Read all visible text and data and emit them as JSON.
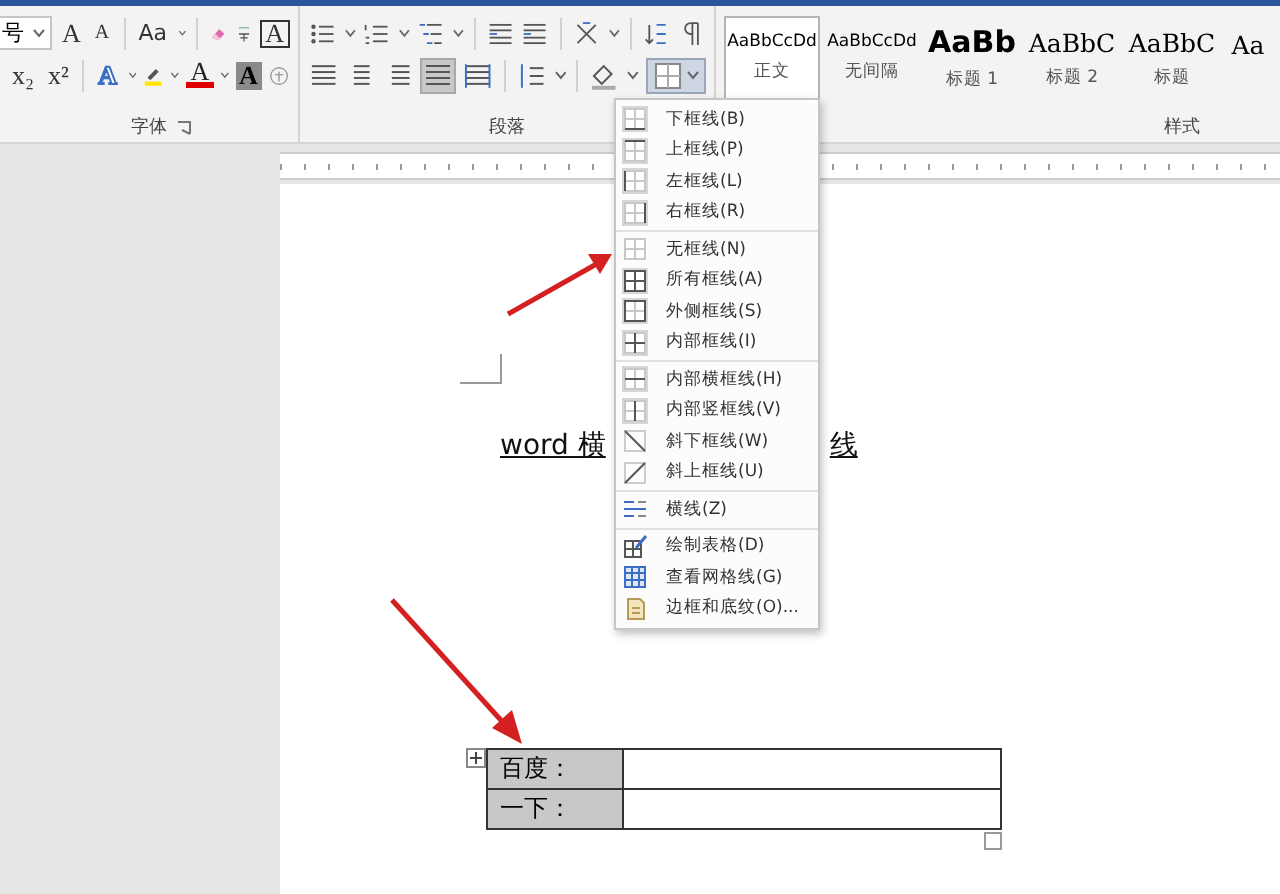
{
  "ribbon": {
    "font": {
      "size_value": "号",
      "row1": [
        {
          "kind": "grow",
          "text": "A"
        },
        {
          "kind": "shrink",
          "text": "A"
        },
        {
          "kind": "case",
          "text": "Aa"
        },
        {
          "kind": "boxed",
          "text": "A"
        }
      ],
      "row2": [
        {
          "kind": "sub",
          "text": "x₂"
        },
        {
          "kind": "sup",
          "text": "x²"
        },
        {
          "kind": "outline",
          "text": "A"
        },
        {
          "kind": "color",
          "text": "A"
        },
        {
          "kind": "shaded",
          "text": "A"
        }
      ],
      "label": "字体"
    },
    "paragraph": {
      "label": "段落"
    },
    "styles": {
      "items": [
        {
          "kind": "normal",
          "preview": "AaBbCcDd",
          "name": "正文",
          "selected": true
        },
        {
          "kind": "normal",
          "preview": "AaBbCcDd",
          "name": "无间隔",
          "selected": false
        },
        {
          "kind": "heading1",
          "preview": "AaBb",
          "name": "标题 1",
          "selected": false
        },
        {
          "kind": "heading2",
          "preview": "AaBbC",
          "name": "标题 2",
          "selected": false
        },
        {
          "kind": "heading2",
          "preview": "AaBbC",
          "name": "标题",
          "selected": false
        },
        {
          "kind": "heading2",
          "preview": "Aa",
          "selected": false
        }
      ],
      "label": "样式"
    }
  },
  "border_menu": {
    "sections": [
      [
        {
          "kind": "bottom",
          "label": "下框线(B)"
        },
        {
          "kind": "top",
          "label": "上框线(P)"
        },
        {
          "kind": "left",
          "label": "左框线(L)"
        },
        {
          "kind": "right",
          "label": "右框线(R)"
        }
      ],
      [
        {
          "kind": "none",
          "label": "无框线(N)"
        },
        {
          "kind": "all",
          "label": "所有框线(A)"
        },
        {
          "kind": "outside",
          "label": "外侧框线(S)"
        },
        {
          "kind": "inside",
          "label": "内部框线(I)"
        }
      ],
      [
        {
          "kind": "inside_h",
          "label": "内部横框线(H)"
        },
        {
          "kind": "inside_v",
          "label": "内部竖框线(V)"
        },
        {
          "kind": "diag_down",
          "label": "斜下框线(W)"
        },
        {
          "kind": "diag_up",
          "label": "斜上框线(U)"
        }
      ],
      [
        {
          "kind": "hline",
          "label": "横线(Z)"
        }
      ],
      [
        {
          "kind": "draw",
          "label": "绘制表格(D)"
        },
        {
          "kind": "grid",
          "label": "查看网格线(G)"
        },
        {
          "kind": "shading",
          "label": "边框和底纹(O)..."
        }
      ]
    ]
  },
  "document": {
    "heading_left": "word 横",
    "heading_right": "线",
    "table": {
      "rows": [
        {
          "label": "百度："
        },
        {
          "label": "一下："
        }
      ]
    }
  }
}
